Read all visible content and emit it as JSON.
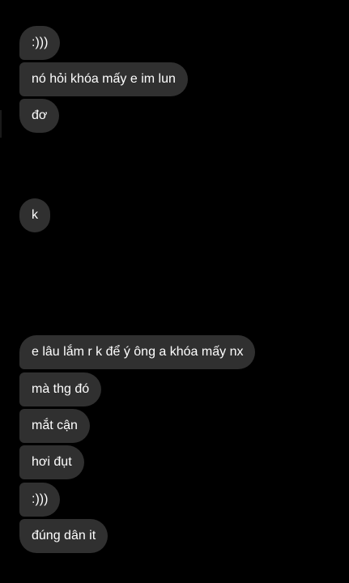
{
  "messages": [
    {
      "text": ":)))"
    },
    {
      "text": "nó hỏi khóa mấy e im lun"
    },
    {
      "text": "đơ"
    },
    {
      "text": "k"
    },
    {
      "text": "e lâu lắm r k để ý ông a khóa mấy nx"
    },
    {
      "text": "mà thg đó"
    },
    {
      "text": "mắt cận"
    },
    {
      "text": "hơi đụt"
    },
    {
      "text": ":)))"
    },
    {
      "text": "đúng dân it"
    }
  ],
  "colors": {
    "background": "#000000",
    "bubble": "#303030",
    "text": "#ffffff"
  }
}
